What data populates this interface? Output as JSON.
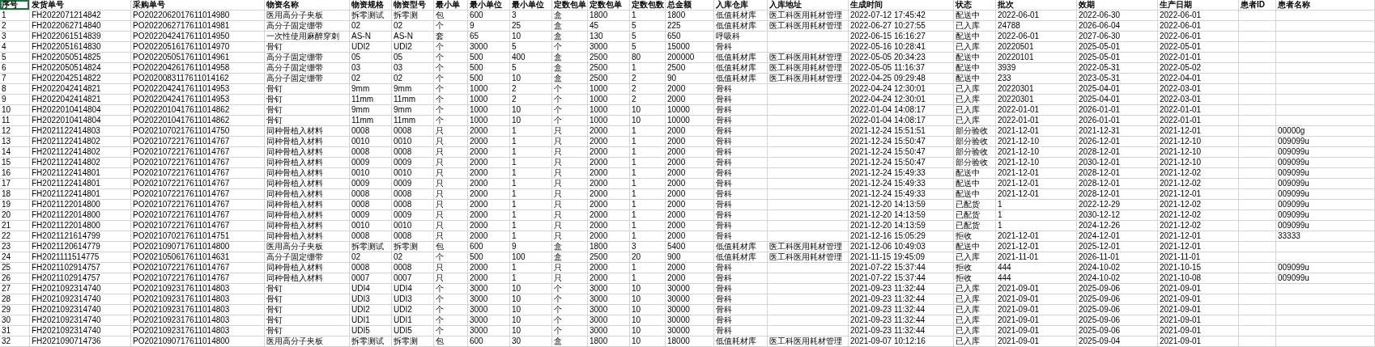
{
  "columns": [
    {
      "label": "序号",
      "selected": true
    },
    {
      "label": "发货单号",
      "selected": false
    },
    {
      "label": "采购单号",
      "selected": false
    },
    {
      "label": "物资名称",
      "selected": false
    },
    {
      "label": "物资规格",
      "selected": false
    },
    {
      "label": "物资型号",
      "selected": false
    },
    {
      "label": "最小单",
      "selected": false
    },
    {
      "label": "最小单位",
      "selected": false
    },
    {
      "label": "最小单位",
      "selected": false
    },
    {
      "label": "定数包单",
      "selected": false
    },
    {
      "label": "定数包单",
      "selected": false
    },
    {
      "label": "定数包数",
      "selected": false
    },
    {
      "label": "总金额",
      "selected": false
    },
    {
      "label": "入库仓库",
      "selected": false
    },
    {
      "label": "入库地址",
      "selected": false
    },
    {
      "label": "生成时间",
      "selected": false
    },
    {
      "label": "状态",
      "selected": false
    },
    {
      "label": "批次",
      "selected": false
    },
    {
      "label": "效期",
      "selected": false
    },
    {
      "label": "生产日期",
      "selected": false
    },
    {
      "label": "患者ID",
      "selected": false
    },
    {
      "label": "患者名称",
      "selected": false
    }
  ],
  "rows": [
    [
      "1",
      "FH2022071214842",
      "PO2022062017611014980",
      "医用高分子夹板",
      "拆零测试",
      "拆零测",
      "包",
      "600",
      "3",
      "盒",
      "1800",
      "1",
      "1800",
      "低值耗材库",
      "医工科医用耗材管理",
      "2022-07-12 17:45:42",
      "配送中",
      "2022-06-01",
      "2022-06-30",
      "2022-06-01",
      null,
      null
    ],
    [
      "2",
      "FH2022062714840",
      "PO2022062717611014981",
      "高分子固定绷带",
      "02",
      "02",
      "个",
      "9",
      "25",
      "盒",
      "45",
      "5",
      "225",
      "低值耗材库",
      "医工科医用耗材管理",
      "2022-06-27 10:27:55",
      "已入库",
      "24788",
      "2026-06-04",
      "2022-06-01",
      null,
      null
    ],
    [
      "3",
      "FH2022061514839",
      "PO2022042417611014950",
      "一次性使用麻醉穿刺",
      "AS-N",
      "AS-N",
      "套",
      "65",
      "10",
      "盒",
      "130",
      "5",
      "650",
      "呼吸科",
      null,
      "2022-06-15 16:16:27",
      "配送中",
      "2022-06-01",
      "2027-06-30",
      "2022-06-01",
      null,
      null
    ],
    [
      "4",
      "FH2022051614830",
      "PO2022051617611014970",
      "骨钉",
      "UDI2",
      "UDI2",
      "个",
      "3000",
      "5",
      "个",
      "3000",
      "5",
      "15000",
      "骨科",
      null,
      "2022-05-16 10:28:41",
      "已入库",
      "20220501",
      "2025-05-01",
      "2022-05-01",
      null,
      null
    ],
    [
      "5",
      "FH2022050514825",
      "PO2022050517611014961",
      "高分子固定绷带",
      "05",
      "05",
      "个",
      "500",
      "400",
      "盒",
      "2500",
      "80",
      "200000",
      "低值耗材库",
      "医工科医用耗材管理",
      "2022-05-05 20:34:23",
      "配送中",
      "20220101",
      "2025-05-01",
      "2022-01-01",
      null,
      null
    ],
    [
      "6",
      "FH2022050514824",
      "PO2022042617611014958",
      "高分子固定绷带",
      "03",
      "03",
      "个",
      "500",
      "5",
      "盒",
      "2500",
      "1",
      "2500",
      "低值耗材库",
      "医工科医用耗材管理",
      "2022-05-05 11:16:37",
      "配送中",
      "3939",
      "2022-05-31",
      "2022-05-02",
      null,
      null
    ],
    [
      "7",
      "FH2022042514822",
      "PO2020083117611014162",
      "高分子固定绷带",
      "02",
      "02",
      "个",
      "500",
      "10",
      "盒",
      "2500",
      "2",
      "90",
      "低值耗材库",
      "医工科医用耗材管理",
      "2022-04-25 09:29:48",
      "配送中",
      "233",
      "2023-05-31",
      "2022-04-01",
      null,
      null
    ],
    [
      "8",
      "FH2022042414821",
      "PO2022042417611014953",
      "骨钉",
      "9mm",
      "9mm",
      "个",
      "1000",
      "2",
      "个",
      "1000",
      "2",
      "2000",
      "骨科",
      null,
      "2022-04-24 12:30:01",
      "已入库",
      "20220301",
      "2025-04-01",
      "2022-03-01",
      null,
      null
    ],
    [
      "9",
      "FH2022042414821",
      "PO2022042417611014953",
      "骨钉",
      "11mm",
      "11mm",
      "个",
      "1000",
      "2",
      "个",
      "1000",
      "2",
      "2000",
      "骨科",
      null,
      "2022-04-24 12:30:01",
      "已入库",
      "20220301",
      "2025-04-01",
      "2022-03-01",
      null,
      null
    ],
    [
      "10",
      "FH2022010414804",
      "PO2022010417611014862",
      "骨钉",
      "9mm",
      "9mm",
      "个",
      "1000",
      "10",
      "个",
      "1000",
      "10",
      "10000",
      "骨科",
      null,
      "2022-01-04 14:08:17",
      "已入库",
      "2022-01-01",
      "2026-01-01",
      "2022-01-01",
      null,
      null
    ],
    [
      "11",
      "FH2022010414804",
      "PO2022010417611014862",
      "骨钉",
      "11mm",
      "11mm",
      "个",
      "1000",
      "10",
      "个",
      "1000",
      "10",
      "10000",
      "骨科",
      null,
      "2022-01-04 14:08:17",
      "已入库",
      "2022-01-01",
      "2026-01-01",
      "2022-01-01",
      null,
      null
    ],
    [
      "12",
      "FH2021122414803",
      "PO2021070217611014750",
      "同种骨植入材料",
      "0008",
      "0008",
      "只",
      "2000",
      "1",
      "只",
      "2000",
      "1",
      "2000",
      "骨科",
      null,
      "2021-12-24 15:51:51",
      "部分验收",
      "2021-12-01",
      "2021-12-31",
      "2021-12-01",
      null,
      "00000g"
    ],
    [
      "13",
      "FH2021122414802",
      "PO2021072217611014767",
      "同种骨植入材料",
      "0010",
      "0010",
      "只",
      "2000",
      "1",
      "只",
      "2000",
      "1",
      "2000",
      "骨科",
      null,
      "2021-12-24 15:50:47",
      "部分验收",
      "2021-12-10",
      "2026-12-01",
      "2021-12-10",
      null,
      "009099u"
    ],
    [
      "14",
      "FH2021122414802",
      "PO2021072217611014767",
      "同种骨植入材料",
      "0008",
      "0008",
      "只",
      "2000",
      "1",
      "只",
      "2000",
      "1",
      "2000",
      "骨科",
      null,
      "2021-12-24 15:50:47",
      "部分验收",
      "2021-12-10",
      "2028-12-01",
      "2021-12-10",
      null,
      "009099u"
    ],
    [
      "15",
      "FH2021122414802",
      "PO2021072217611014767",
      "同种骨植入材料",
      "0009",
      "0009",
      "只",
      "2000",
      "1",
      "只",
      "2000",
      "1",
      "2000",
      "骨科",
      null,
      "2021-12-24 15:50:47",
      "部分验收",
      "2021-12-10",
      "2030-12-01",
      "2021-12-10",
      null,
      "009099u"
    ],
    [
      "16",
      "FH2021122414801",
      "PO2021072217611014767",
      "同种骨植入材料",
      "0010",
      "0010",
      "只",
      "2000",
      "1",
      "只",
      "2000",
      "1",
      "2000",
      "骨科",
      null,
      "2021-12-24 15:49:33",
      "配送中",
      "2021-12-01",
      "2028-12-01",
      "2021-12-02",
      null,
      "009099u"
    ],
    [
      "17",
      "FH2021122414801",
      "PO2021072217611014767",
      "同种骨植入材料",
      "0009",
      "0009",
      "只",
      "2000",
      "1",
      "只",
      "2000",
      "1",
      "2000",
      "骨科",
      null,
      "2021-12-24 15:49:33",
      "配送中",
      "2021-12-01",
      "2028-12-01",
      "2021-12-02",
      null,
      "009099u"
    ],
    [
      "18",
      "FH2021122414801",
      "PO2021072217611014767",
      "同种骨植入材料",
      "0008",
      "0008",
      "只",
      "2000",
      "1",
      "只",
      "2000",
      "1",
      "2000",
      "骨科",
      null,
      "2021-12-24 15:49:33",
      "配送中",
      "2021-12-01",
      "2028-12-01",
      "2021-12-01",
      null,
      "009099u"
    ],
    [
      "19",
      "FH2021122014800",
      "PO2021072217611014767",
      "同种骨植入材料",
      "0008",
      "0008",
      "只",
      "2000",
      "1",
      "只",
      "2000",
      "1",
      "2000",
      "骨科",
      null,
      "2021-12-20 14:13:59",
      "已配货",
      "1",
      "2022-12-29",
      "2021-12-02",
      null,
      "009099u"
    ],
    [
      "20",
      "FH2021122014800",
      "PO2021072217611014767",
      "同种骨植入材料",
      "0009",
      "0009",
      "只",
      "2000",
      "1",
      "只",
      "2000",
      "1",
      "2000",
      "骨科",
      null,
      "2021-12-20 14:13:59",
      "已配货",
      "1",
      "2030-12-12",
      "2021-12-02",
      null,
      "009099u"
    ],
    [
      "21",
      "FH2021122014800",
      "PO2021072217611014767",
      "同种骨植入材料",
      "0010",
      "0010",
      "只",
      "2000",
      "1",
      "只",
      "2000",
      "1",
      "2000",
      "骨科",
      null,
      "2021-12-20 14:13:59",
      "已配货",
      "1",
      "2024-12-26",
      "2021-12-02",
      null,
      "009099u"
    ],
    [
      "22",
      "FH2021121614799",
      "PO2021070217611014751",
      "同种骨植入材料",
      "0008",
      "0008",
      "只",
      "2000",
      "1",
      "只",
      "2000",
      "1",
      "2000",
      "骨科",
      null,
      "2021-12-16 15:05:29",
      "拒收",
      "2021-12-01",
      "2024-12-01",
      "2021-12-01",
      null,
      "33333"
    ],
    [
      "23",
      "FH2021120614779",
      "PO2021090717611014800",
      "医用高分子夹板",
      "拆零测试",
      "拆零测",
      "包",
      "600",
      "9",
      "盒",
      "1800",
      "3",
      "5400",
      "低值耗材库",
      "医工科医用耗材管理",
      "2021-12-06 10:49:03",
      "配送中",
      "2021-12-01",
      "2025-12-01",
      "2021-12-01",
      null,
      null
    ],
    [
      "24",
      "FH2021111514775",
      "PO2021050617611014631",
      "高分子固定绷带",
      "02",
      "02",
      "个",
      "500",
      "100",
      "盒",
      "2500",
      "20",
      "900",
      "低值耗材库",
      "医工科医用耗材管理",
      "2021-11-15 19:45:09",
      "已入库",
      "2021-11-01",
      "2026-11-01",
      "2021-11-01",
      null,
      null
    ],
    [
      "25",
      "FH2021102914757",
      "PO2021072217611014767",
      "同种骨植入材料",
      "0008",
      "0008",
      "只",
      "2000",
      "1",
      "只",
      "2000",
      "1",
      "2000",
      "骨科",
      null,
      "2021-07-22 15:37:44",
      "拒收",
      "444",
      "2024-10-02",
      "2021-10-15",
      null,
      "009099u"
    ],
    [
      "26",
      "FH2021102914757",
      "PO2021072217611014767",
      "同种骨植入材料",
      "0007",
      "0007",
      "只",
      "2000",
      "1",
      "只",
      "2000",
      "1",
      "2000",
      "骨科",
      null,
      "2021-07-22 15:37:44",
      "拒收",
      "444",
      "2024-10-02",
      "2021-10-08",
      null,
      "009099u"
    ],
    [
      "27",
      "FH2021092314740",
      "PO2021092317611014803",
      "骨钉",
      "UDI4",
      "UDI4",
      "个",
      "3000",
      "10",
      "个",
      "3000",
      "10",
      "30000",
      "骨科",
      null,
      "2021-09-23 11:32:44",
      "已入库",
      "2021-09-01",
      "2025-09-06",
      "2021-09-01",
      null,
      null
    ],
    [
      "28",
      "FH2021092314740",
      "PO2021092317611014803",
      "骨钉",
      "UDI3",
      "UDI3",
      "个",
      "3000",
      "10",
      "个",
      "3000",
      "10",
      "30000",
      "骨科",
      null,
      "2021-09-23 11:32:44",
      "已入库",
      "2021-09-01",
      "2025-09-06",
      "2021-09-01",
      null,
      null
    ],
    [
      "29",
      "FH2021092314740",
      "PO2021092317611014803",
      "骨钉",
      "UDI2",
      "UDI2",
      "个",
      "3000",
      "10",
      "个",
      "3000",
      "10",
      "30000",
      "骨科",
      null,
      "2021-09-23 11:32:44",
      "已入库",
      "2021-09-01",
      "2025-09-06",
      "2021-09-01",
      null,
      null
    ],
    [
      "30",
      "FH2021092314740",
      "PO2021092317611014803",
      "骨钉",
      "UDI1",
      "UDI1",
      "个",
      "3000",
      "10",
      "个",
      "3000",
      "10",
      "30000",
      "骨科",
      null,
      "2021-09-23 11:32:44",
      "已入库",
      "2021-09-01",
      "2025-09-06",
      "2021-09-01",
      null,
      null
    ],
    [
      "31",
      "FH2021092314740",
      "PO2021092317611014803",
      "骨钉",
      "UDI5",
      "UDI5",
      "个",
      "3000",
      "10",
      "个",
      "3000",
      "10",
      "30000",
      "骨科",
      null,
      "2021-09-23 11:32:44",
      "已入库",
      "2021-09-01",
      "2025-09-06",
      "2021-09-01",
      null,
      null
    ],
    [
      "32",
      "FH2021090714736",
      "PO2021090717611014800",
      "医用高分子夹板",
      "拆零测试",
      "拆零测",
      "包",
      "600",
      "30",
      "盒",
      "1800",
      "10",
      "18000",
      "低值耗材库",
      "医工科医用耗材管理",
      "2021-09-07 10:12:16",
      "已入库",
      "2021-09-01",
      "2025-09-04",
      "2021-09-01",
      null,
      null
    ]
  ]
}
